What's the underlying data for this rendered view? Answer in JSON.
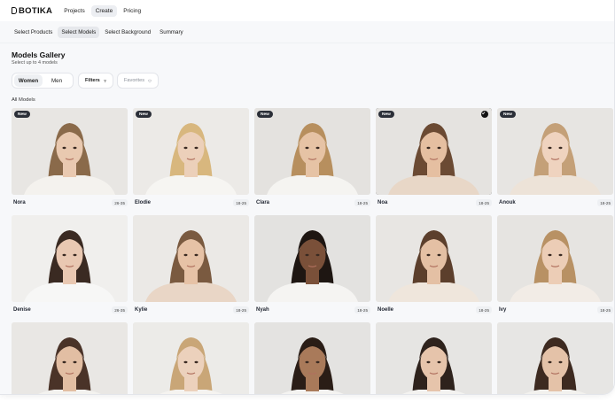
{
  "app": {
    "brand": "BOTIKA"
  },
  "nav": [
    {
      "label": "Projects",
      "active": false
    },
    {
      "label": "Create",
      "active": true
    },
    {
      "label": "Pricing",
      "active": false
    }
  ],
  "steps": [
    {
      "label": "Select Products",
      "active": false
    },
    {
      "label": "Select Models",
      "active": true
    },
    {
      "label": "Select Background",
      "active": false
    },
    {
      "label": "Summary",
      "active": false
    }
  ],
  "gallery": {
    "title": "Models Gallery",
    "subtitle": "Select up to 4 models",
    "gender": {
      "women_label": "Women",
      "men_label": "Men",
      "selected": "Women"
    },
    "filters_label": "Filters",
    "favorites_label": "Favorites",
    "section_label": "All Models"
  },
  "models": [
    {
      "name": "Nora",
      "age": "26-35",
      "new": true,
      "selected": false,
      "bg": "#e8e6e3",
      "hair": "#8a6a4a",
      "skin": "#e9c9b0",
      "top": "#f4f2ee"
    },
    {
      "name": "Elodie",
      "age": "18-25",
      "new": true,
      "selected": false,
      "bg": "#eceae7",
      "hair": "#d8b77e",
      "skin": "#ecd0ba",
      "top": "#f6f5f2"
    },
    {
      "name": "Clara",
      "age": "18-25",
      "new": true,
      "selected": false,
      "bg": "#e4e2df",
      "hair": "#b78f5e",
      "skin": "#e6c3a5",
      "top": "#f5f4f1"
    },
    {
      "name": "Noa",
      "age": "18-25",
      "new": true,
      "selected": true,
      "bg": "#e5e3e0",
      "hair": "#6b4a33",
      "skin": "#e5bfa1",
      "top": "#e8d7c7"
    },
    {
      "name": "Anouk",
      "age": "18-25",
      "new": true,
      "selected": false,
      "bg": "#e7e5e2",
      "hair": "#c4a078",
      "skin": "#efd3bf",
      "top": "#ede3d8"
    },
    {
      "name": "Denise",
      "age": "26-35",
      "new": false,
      "selected": false,
      "bg": "#f0efed",
      "hair": "#3a2a22",
      "skin": "#e9c8b2",
      "top": "#f7f7f6"
    },
    {
      "name": "Kylie",
      "age": "18-25",
      "new": false,
      "selected": false,
      "bg": "#ebe9e6",
      "hair": "#7a5a40",
      "skin": "#e6c2a6",
      "top": "#e9d6c6"
    },
    {
      "name": "Nyah",
      "age": "18-25",
      "new": false,
      "selected": false,
      "bg": "#e3e2e0",
      "hair": "#1e1612",
      "skin": "#7a5039",
      "top": "#f5f4f2"
    },
    {
      "name": "Noelle",
      "age": "18-25",
      "new": false,
      "selected": false,
      "bg": "#e8e6e3",
      "hair": "#5c3f2c",
      "skin": "#e4c0a4",
      "top": "#efe6dc"
    },
    {
      "name": "Ivy",
      "age": "18-25",
      "new": false,
      "selected": false,
      "bg": "#e6e4e1",
      "hair": "#b89164",
      "skin": "#eccdb6",
      "top": "#f2ece6"
    },
    {
      "name": "",
      "age": "",
      "new": false,
      "selected": false,
      "bg": "#e9e7e4",
      "hair": "#4a3328",
      "skin": "#e2bea3",
      "top": "#f3f2ef"
    },
    {
      "name": "",
      "age": "",
      "new": false,
      "selected": false,
      "bg": "#ecebe8",
      "hair": "#c9a677",
      "skin": "#ecd1bc",
      "top": "#f5f3f0"
    },
    {
      "name": "",
      "age": "",
      "new": false,
      "selected": false,
      "bg": "#e4e3e1",
      "hair": "#2a1d16",
      "skin": "#a97a5a",
      "top": "#f4f3f1"
    },
    {
      "name": "",
      "age": "",
      "new": false,
      "selected": false,
      "bg": "#e6e5e3",
      "hair": "#2e221c",
      "skin": "#e6c4ab",
      "top": "#f3f2f0"
    },
    {
      "name": "",
      "age": "",
      "new": false,
      "selected": false,
      "bg": "#e7e6e4",
      "hair": "#3d2a20",
      "skin": "#e4c2a8",
      "top": "#f2f1ee"
    }
  ],
  "colors": {
    "accent": "#111111",
    "badge": "#2b2f38",
    "page_bg": "#f7f8fa"
  }
}
